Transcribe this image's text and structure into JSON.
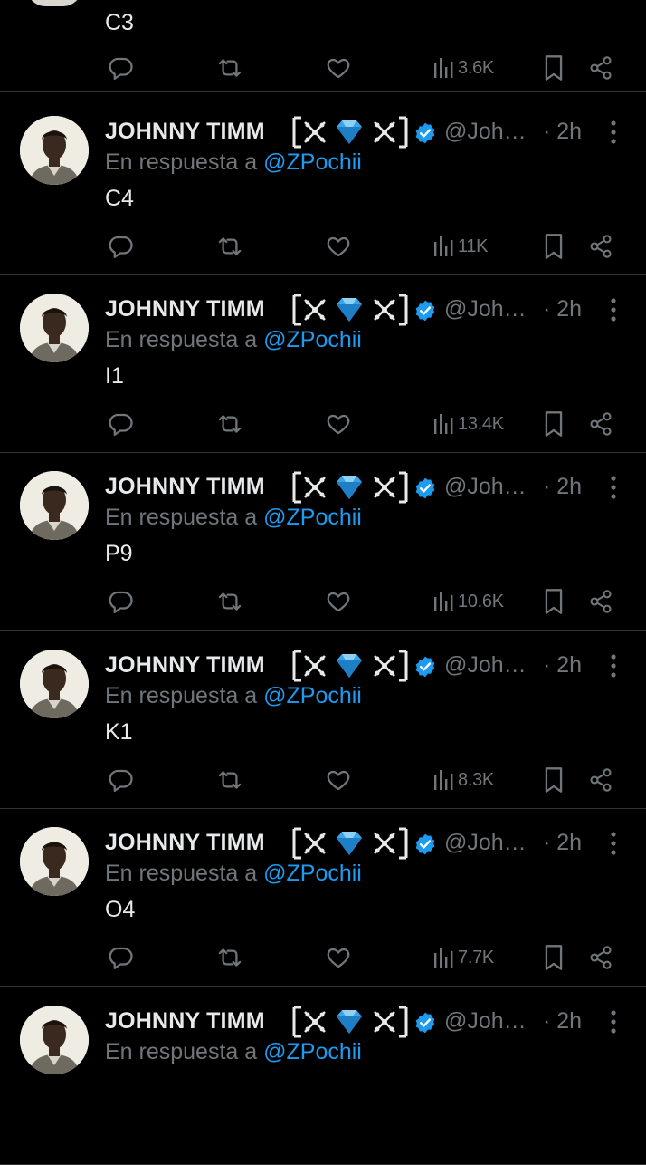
{
  "tweets": [
    {
      "text": "C3",
      "views": "3.6K",
      "partial": "top"
    },
    {
      "name": "JOHNNY TIMM",
      "handle": "@Joh…",
      "time": "· 2h",
      "reply_prefix": "En respuesta a",
      "reply_to": "@ZPochii",
      "text": "C4",
      "views": "11K"
    },
    {
      "name": "JOHNNY TIMM",
      "handle": "@Joh…",
      "time": "· 2h",
      "reply_prefix": "En respuesta a",
      "reply_to": "@ZPochii",
      "text": "I1",
      "views": "13.4K"
    },
    {
      "name": "JOHNNY TIMM",
      "handle": "@Joh…",
      "time": "· 2h",
      "reply_prefix": "En respuesta a",
      "reply_to": "@ZPochii",
      "text": "P9",
      "views": "10.6K"
    },
    {
      "name": "JOHNNY TIMM",
      "handle": "@Joh…",
      "time": "· 2h",
      "reply_prefix": "En respuesta a",
      "reply_to": "@ZPochii",
      "text": "K1",
      "views": "8.3K"
    },
    {
      "name": "JOHNNY TIMM",
      "handle": "@Joh…",
      "time": "· 2h",
      "reply_prefix": "En respuesta a",
      "reply_to": "@ZPochii",
      "text": "O4",
      "views": "7.7K"
    },
    {
      "name": "JOHNNY TIMM",
      "handle": "@Joh…",
      "time": "· 2h",
      "reply_prefix": "En respuesta a",
      "reply_to": "@ZPochii",
      "text": "",
      "partial": "bottom"
    }
  ],
  "icons": {
    "reply": "reply-icon",
    "retweet": "retweet-icon",
    "like": "heart-icon",
    "views": "views-chart-icon",
    "bookmark": "bookmark-icon",
    "share": "share-icon",
    "verified": "verified-badge-icon",
    "more": "more-options-icon"
  },
  "colors": {
    "background": "#000000",
    "text": "#e7e9ea",
    "muted": "#71767b",
    "accent": "#1d9bf0",
    "divider": "#2f3336"
  }
}
